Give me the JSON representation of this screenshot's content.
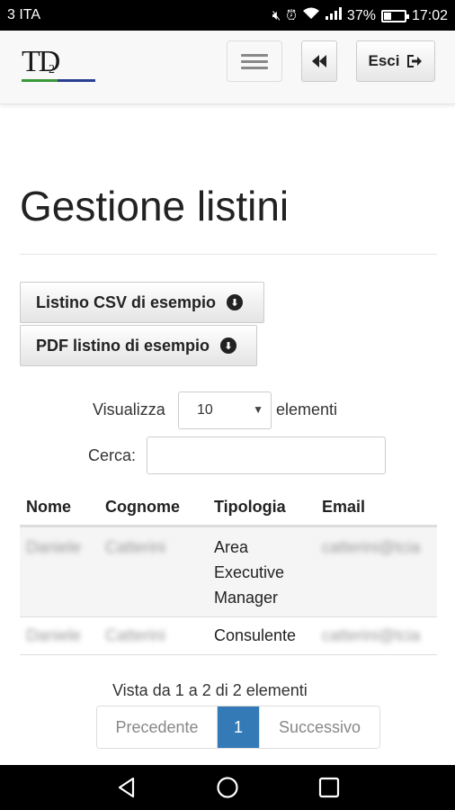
{
  "status_bar": {
    "carrier": "3 ITA",
    "battery": "37%",
    "battery_level": 0.37,
    "time": "17:02",
    "icons": [
      "mute-icon",
      "alarm-icon",
      "wifi-icon",
      "signal-icon",
      "battery-icon"
    ]
  },
  "navbar": {
    "logo_text": "TD",
    "logo_sub": "2",
    "back_icon": "fast-backward-icon",
    "exit_label": "Esci",
    "exit_icon": "log-out-icon"
  },
  "page": {
    "title": "Gestione listini"
  },
  "downloads": {
    "csv_label": "Listino CSV di esempio",
    "pdf_label": "PDF listino di esempio"
  },
  "length_control": {
    "prefix": "Visualizza",
    "selected": "10",
    "suffix": "elementi"
  },
  "search": {
    "label": "Cerca:",
    "value": ""
  },
  "table": {
    "columns": [
      "Nome",
      "Cognome",
      "Tipologia",
      "Email"
    ],
    "rows": [
      {
        "nome": "Daniele",
        "cognome": "Catterini",
        "tipologia_lines": [
          "Area",
          "Executive",
          "Manager"
        ],
        "email": "catterini@tcia"
      },
      {
        "nome": "Daniele",
        "cognome": "Catterini",
        "tipologia_lines": [
          "Consulente"
        ],
        "email": "catterini@tcia"
      }
    ]
  },
  "pagination": {
    "info": "Vista da 1 a 2 di 2 elementi",
    "prev": "Precedente",
    "current": "1",
    "next": "Successivo"
  }
}
